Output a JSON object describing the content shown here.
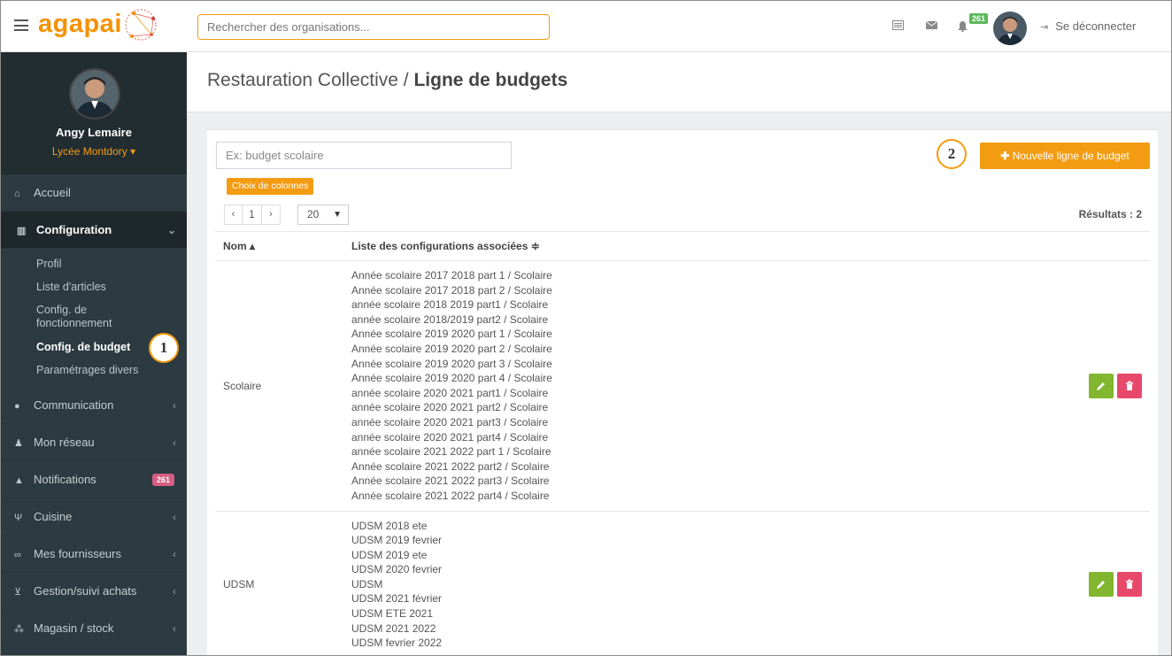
{
  "app": {
    "logo_text": "agapai",
    "search_placeholder": "Rechercher des organisations...",
    "notif_count": "261",
    "logout_label": "Se déconnecter"
  },
  "sidebar": {
    "user_name": "Angy Lemaire",
    "school": "Lycée Montdory ▾",
    "items": [
      {
        "label": "Accueil",
        "icon": "home-icon"
      },
      {
        "label": "Configuration",
        "icon": "institution-icon"
      },
      {
        "label": "Communication",
        "icon": "comments-icon"
      },
      {
        "label": "Mon réseau",
        "icon": "users-icon"
      },
      {
        "label": "Notifications",
        "icon": "bell-icon",
        "badge": "261"
      },
      {
        "label": "Cuisine",
        "icon": "cutlery-icon"
      },
      {
        "label": "Mes fournisseurs",
        "icon": "handshake-icon"
      },
      {
        "label": "Gestion/suivi achats",
        "icon": "cart-icon"
      },
      {
        "label": "Magasin / stock",
        "icon": "cubes-icon"
      }
    ],
    "submenu": [
      "Profil",
      "Liste d'articles",
      "Config. de fonctionnement",
      "Config. de budget",
      "Paramétrages divers"
    ]
  },
  "header": {
    "breadcrumb": "Restauration Collective / ",
    "title": "Ligne de budgets"
  },
  "toolbar": {
    "filter_placeholder": "Ex: budget scolaire",
    "columns_button": "Choix de colonnes",
    "new_button": "Nouvelle ligne de budget",
    "page": "1",
    "per_page": "20",
    "results": "Résultats : 2"
  },
  "callouts": [
    "1",
    "2"
  ],
  "table": {
    "columns": [
      "Nom ▴",
      "Liste des configurations associées ≑"
    ],
    "rows": [
      {
        "name": "Scolaire",
        "configs": [
          "Année scolaire 2017 2018 part 1 / Scolaire",
          "Année scolaire 2017 2018 part 2 / Scolaire",
          "année scolaire 2018 2019 part1 / Scolaire",
          "année scolaire 2018/2019 part2 / Scolaire",
          "Année scolaire 2019 2020 part 1 / Scolaire",
          "Année scolaire 2019 2020 part 2 / Scolaire",
          "Année scolaire 2019 2020 part 3 / Scolaire",
          "Année scolaire 2019 2020 part 4 / Scolaire",
          "année scolaire 2020 2021 part1 / Scolaire",
          "année scolaire 2020 2021 part2 / Scolaire",
          "année scolaire 2020 2021 part3 / Scolaire",
          "année scolaire 2020 2021 part4 / Scolaire",
          "année scolaire 2021 2022 part 1 / Scolaire",
          "Année scolaire 2021 2022 part2 / Scolaire",
          "Année scolaire 2021 2022 part3 / Scolaire",
          "Année scolaire 2021 2022 part4 / Scolaire"
        ]
      },
      {
        "name": "UDSM",
        "configs": [
          "UDSM 2018 ete",
          "UDSM 2019 fevrier",
          "UDSM 2019 ete",
          "UDSM 2020 fevrier",
          "UDSM",
          "UDSM 2021 février",
          "UDSM ETE 2021",
          "UDSM 2021 2022",
          "UDSM fevrier 2022"
        ]
      }
    ]
  },
  "colors": {
    "accent": "#f39c12",
    "sidebar_bg": "#2c3b41",
    "edit": "#81b62e",
    "delete": "#e8496b"
  }
}
